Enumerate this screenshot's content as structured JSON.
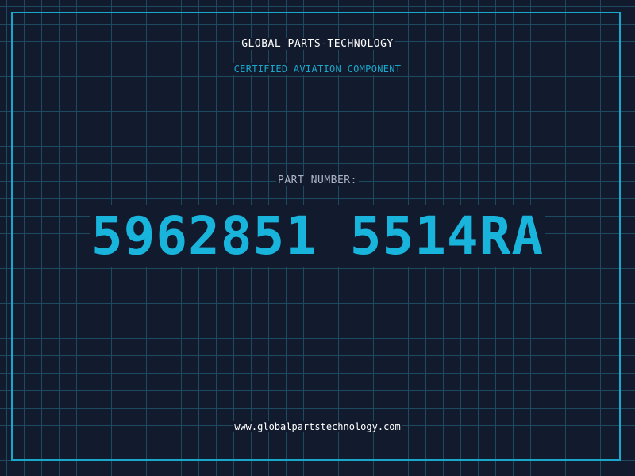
{
  "header": {
    "company": "GLOBAL PARTS-TECHNOLOGY",
    "tagline": "CERTIFIED AVIATION COMPONENT"
  },
  "part": {
    "label": "PART NUMBER:",
    "number": "5962851 5514RA"
  },
  "footer": {
    "website": "www.globalpartstechnology.com"
  },
  "colors": {
    "background": "#121a2e",
    "grid": "#1d4a5e",
    "accent": "#1aa7c9",
    "part_number": "#18b4dc",
    "text": "#ffffff",
    "label": "#a9b4c6"
  }
}
